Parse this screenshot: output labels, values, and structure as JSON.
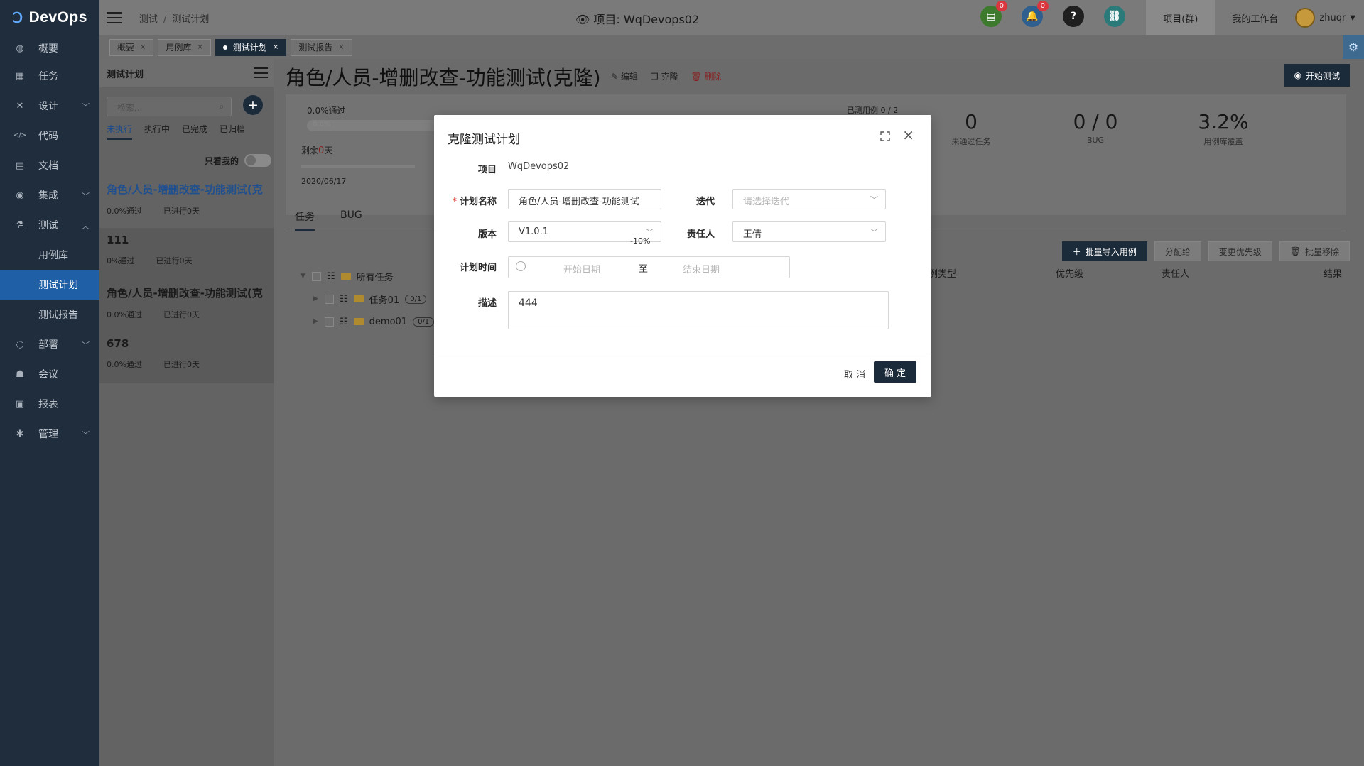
{
  "app": {
    "name": "DevOps"
  },
  "sidebar": {
    "items": [
      {
        "label": "概要",
        "icon": "dashboard-icon",
        "glyph": "◍"
      },
      {
        "label": "任务",
        "icon": "task-icon",
        "glyph": "▦"
      },
      {
        "label": "设计",
        "icon": "design-icon",
        "glyph": "✕"
      },
      {
        "label": "代码",
        "icon": "code-icon",
        "glyph": "</>"
      },
      {
        "label": "文档",
        "icon": "document-icon",
        "glyph": "▤"
      },
      {
        "label": "集成",
        "icon": "integration-icon",
        "glyph": "◉"
      },
      {
        "label": "测试",
        "icon": "flask-icon",
        "glyph": "⚗"
      },
      {
        "label": "用例库"
      },
      {
        "label": "测试计划"
      },
      {
        "label": "测试报告"
      },
      {
        "label": "部署",
        "icon": "deploy-icon",
        "glyph": "◌"
      },
      {
        "label": "会议",
        "icon": "meeting-icon",
        "glyph": "☗"
      },
      {
        "label": "报表",
        "icon": "report-icon",
        "glyph": "▣"
      },
      {
        "label": "管理",
        "icon": "gear-icon",
        "glyph": "✱"
      }
    ]
  },
  "topbar": {
    "breadcrumb": [
      "测试",
      "测试计划"
    ],
    "project_label": "项目: WqDevops02",
    "badges": {
      "todo": "0",
      "notifications": "0"
    },
    "project_group": "项目(群)",
    "workbench": "我的工作台",
    "user": "zhuqr"
  },
  "tabs": [
    {
      "label": "概要"
    },
    {
      "label": "用例库"
    },
    {
      "label": "测试计划"
    },
    {
      "label": "测试报告"
    }
  ],
  "plan_panel": {
    "title": "测试计划",
    "search_placeholder": "检索...",
    "filters": [
      "未执行",
      "执行中",
      "已完成",
      "已归档"
    ],
    "only_mine": "只看我的",
    "plans": [
      {
        "title": "角色/人员-增删改查-功能测试(克",
        "pass": "0.0%通过",
        "progress": "已进行0天"
      },
      {
        "title": "111",
        "pass": "0%通过",
        "progress": "已进行0天"
      },
      {
        "title": "角色/人员-增删改查-功能测试(克",
        "pass": "0.0%通过",
        "progress": "已进行0天"
      },
      {
        "title": "678",
        "pass": "0.0%通过",
        "progress": "已进行0天"
      }
    ]
  },
  "main": {
    "title": "角色/人员-增删改查-功能测试(克隆)",
    "actions": {
      "edit": "编辑",
      "clone": "克隆",
      "delete": "删除"
    },
    "start_test": "开始测试",
    "stats": {
      "pass_rate": "0.0%通过",
      "bar_text": "0.0%",
      "remain_prefix": "剩余",
      "remain_days": "0",
      "remain_suffix": "天",
      "date": "2020/06/17",
      "cases_tested": "已测用例 0 / 2",
      "failed_tasks": "0",
      "failed_tasks_label": "未通过任务",
      "bug": "0 / 0",
      "bug_label": "BUG",
      "coverage": "3.2%",
      "coverage_label": "用例库覆盖"
    },
    "subtabs": [
      "任务",
      "BUG"
    ],
    "buttons": {
      "import": "批量导入用例",
      "assign": "分配给",
      "priority": "变更优先级",
      "remove": "批量移除"
    },
    "columns": {
      "type": "例类型",
      "priority": "优先级",
      "owner": "责任人",
      "result": "结果"
    },
    "tree": {
      "root": "所有任务",
      "children": [
        {
          "label": "任务01",
          "count": "0/1"
        },
        {
          "label": "demo01",
          "count": "0/1"
        }
      ]
    }
  },
  "modal": {
    "title": "克隆测试计划",
    "project_label": "项目",
    "project_value": "WqDevops02",
    "name_label": "计划名称",
    "name_value": "角色/人员-增删改查-功能测试",
    "iteration_label": "迭代",
    "iteration_placeholder": "请选择迭代",
    "version_label": "版本",
    "version_value": "V1.0.1",
    "version_tip": "-10%",
    "owner_label": "责任人",
    "owner_value": "王倩",
    "time_label": "计划时间",
    "start_placeholder": "开始日期",
    "range_sep": "至",
    "end_placeholder": "结束日期",
    "desc_label": "描述",
    "desc_value": "444",
    "cancel": "取 消",
    "ok": "确 定"
  }
}
